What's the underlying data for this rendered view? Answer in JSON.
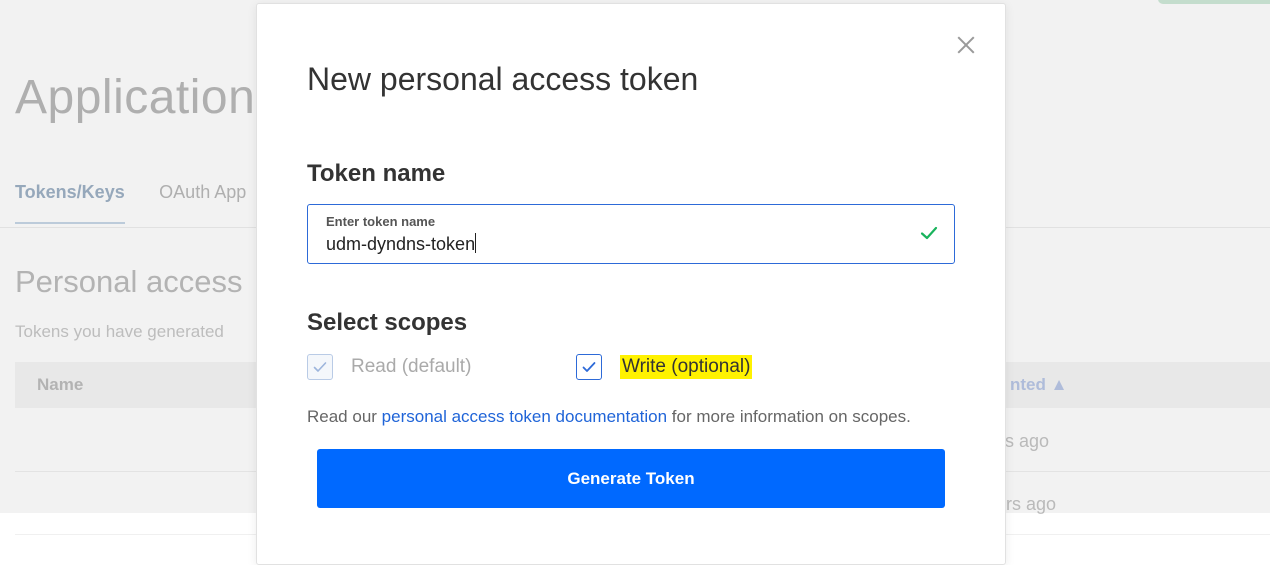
{
  "background": {
    "page_title": "Applications",
    "tabs": [
      {
        "label": "Tokens/Keys",
        "active": true
      },
      {
        "label": "OAuth App",
        "active": false
      }
    ],
    "section_title": "Personal access",
    "section_subtitle": "Tokens you have generated",
    "table": {
      "col_name": "Name",
      "col_created": "nted ▲",
      "rows": [
        {
          "created": "ys ago"
        },
        {
          "created": "ars ago"
        }
      ]
    }
  },
  "modal": {
    "title": "New personal access token",
    "token_section_label": "Token name",
    "input": {
      "caption": "Enter token name",
      "value": "udm-dyndns-token"
    },
    "scopes_label": "Select scopes",
    "scopes": [
      {
        "label": "Read (default)",
        "checked": true,
        "disabled": true
      },
      {
        "label": "Write (optional)",
        "checked": true,
        "disabled": false
      }
    ],
    "info": {
      "prefix": "Read our ",
      "link": "personal access token documentation",
      "suffix": " for more information on scopes."
    },
    "generate_button": "Generate Token"
  },
  "colors": {
    "primary": "#0069ff",
    "input_border": "#2d6ad8",
    "valid_check": "#19b35c",
    "highlight": "#fff200"
  }
}
